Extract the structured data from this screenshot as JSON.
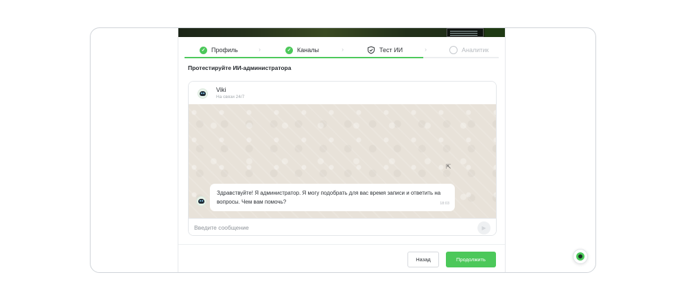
{
  "steps": [
    {
      "label": "Профиль",
      "state": "done",
      "icon": "check-circle-icon"
    },
    {
      "label": "Каналы",
      "state": "done",
      "icon": "check-circle-icon"
    },
    {
      "label": "Тест ИИ",
      "state": "current",
      "icon": "shield-check-icon"
    },
    {
      "label": "Аналитик",
      "state": "pending",
      "icon": "search-icon"
    }
  ],
  "progress_fraction": 0.76,
  "section_title": "Протестируйте ИИ-администратора",
  "chat": {
    "bot_name": "Viki",
    "bot_status": "На связи 24/7",
    "messages": [
      {
        "text": "Здравствуйте! Я администратор. Я могу подобрать для вас время записи и ответить на вопросы. Чем вам помочь?",
        "time": "18:03"
      }
    ],
    "input_placeholder": "Введите сообщение"
  },
  "buttons": {
    "back": "Назад",
    "next": "Продолжить"
  },
  "colors": {
    "accent": "#4cc85a",
    "chat_bg": "#e8e2d9"
  }
}
